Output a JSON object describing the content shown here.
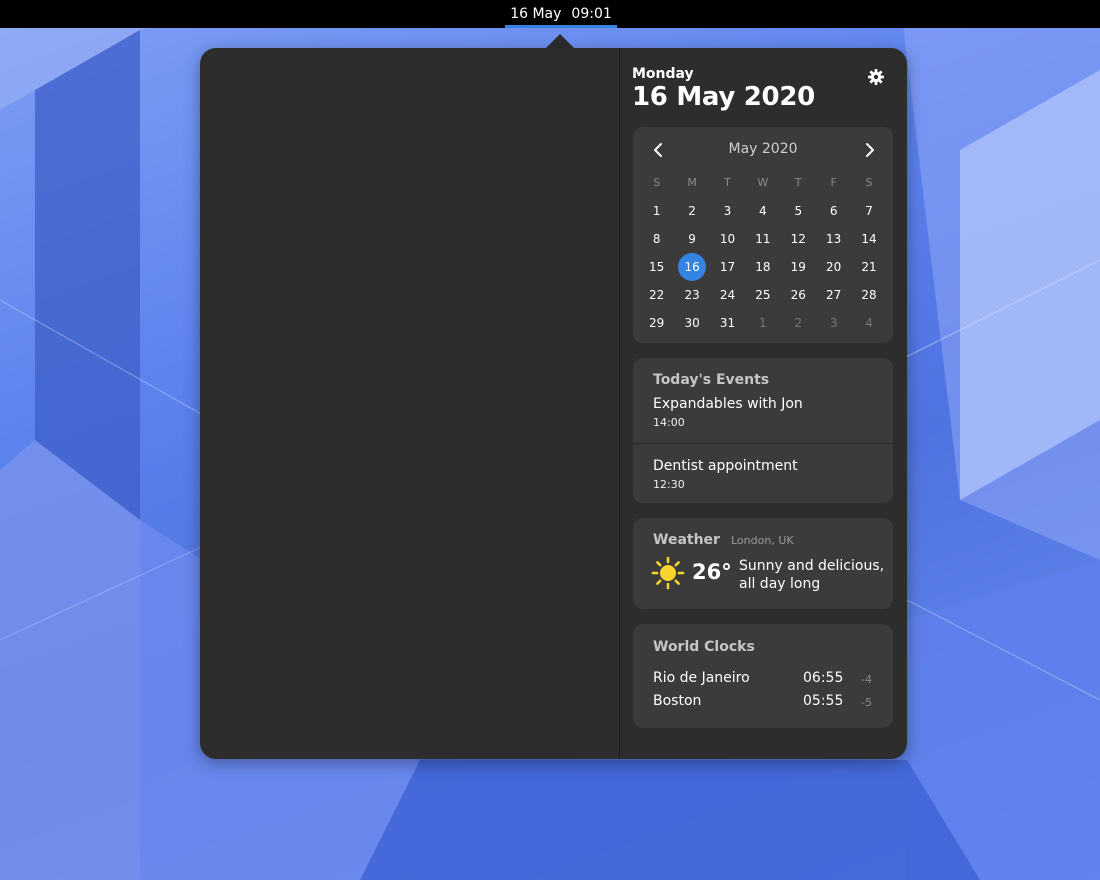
{
  "topbar": {
    "date": "16 May",
    "time": "09:01"
  },
  "header": {
    "weekday": "Monday",
    "full_date": "16 May 2020"
  },
  "settings_icon": "gear-icon",
  "calendar": {
    "month_label": "May 2020",
    "weekday_headers": [
      "S",
      "M",
      "T",
      "W",
      "T",
      "F",
      "S"
    ],
    "weeks": [
      [
        {
          "d": "1"
        },
        {
          "d": "2"
        },
        {
          "d": "3"
        },
        {
          "d": "4"
        },
        {
          "d": "5"
        },
        {
          "d": "6"
        },
        {
          "d": "7"
        }
      ],
      [
        {
          "d": "8"
        },
        {
          "d": "9"
        },
        {
          "d": "10"
        },
        {
          "d": "11"
        },
        {
          "d": "12"
        },
        {
          "d": "13"
        },
        {
          "d": "14"
        }
      ],
      [
        {
          "d": "15"
        },
        {
          "d": "16",
          "today": true
        },
        {
          "d": "17"
        },
        {
          "d": "18"
        },
        {
          "d": "19"
        },
        {
          "d": "20"
        },
        {
          "d": "21"
        }
      ],
      [
        {
          "d": "22"
        },
        {
          "d": "23"
        },
        {
          "d": "24"
        },
        {
          "d": "25"
        },
        {
          "d": "26"
        },
        {
          "d": "27"
        },
        {
          "d": "28"
        }
      ],
      [
        {
          "d": "29"
        },
        {
          "d": "30"
        },
        {
          "d": "31"
        },
        {
          "d": "1",
          "other": true
        },
        {
          "d": "2",
          "other": true
        },
        {
          "d": "3",
          "other": true
        },
        {
          "d": "4",
          "other": true
        }
      ]
    ],
    "accent_color": "#3584e4"
  },
  "events": {
    "title": "Today's Events",
    "items": [
      {
        "name": "Expandables with Jon",
        "time": "14:00"
      },
      {
        "name": "Dentist appointment",
        "time": "12:30"
      }
    ]
  },
  "weather": {
    "title": "Weather",
    "location": "London, UK",
    "icon": "sun-icon",
    "temperature": "26°",
    "description": "Sunny and delicious, all day long"
  },
  "world_clocks": {
    "title": "World Clocks",
    "items": [
      {
        "city": "Rio de Janeiro",
        "time": "06:55",
        "offset": "-4"
      },
      {
        "city": "Boston",
        "time": "05:55",
        "offset": "-5"
      }
    ]
  }
}
